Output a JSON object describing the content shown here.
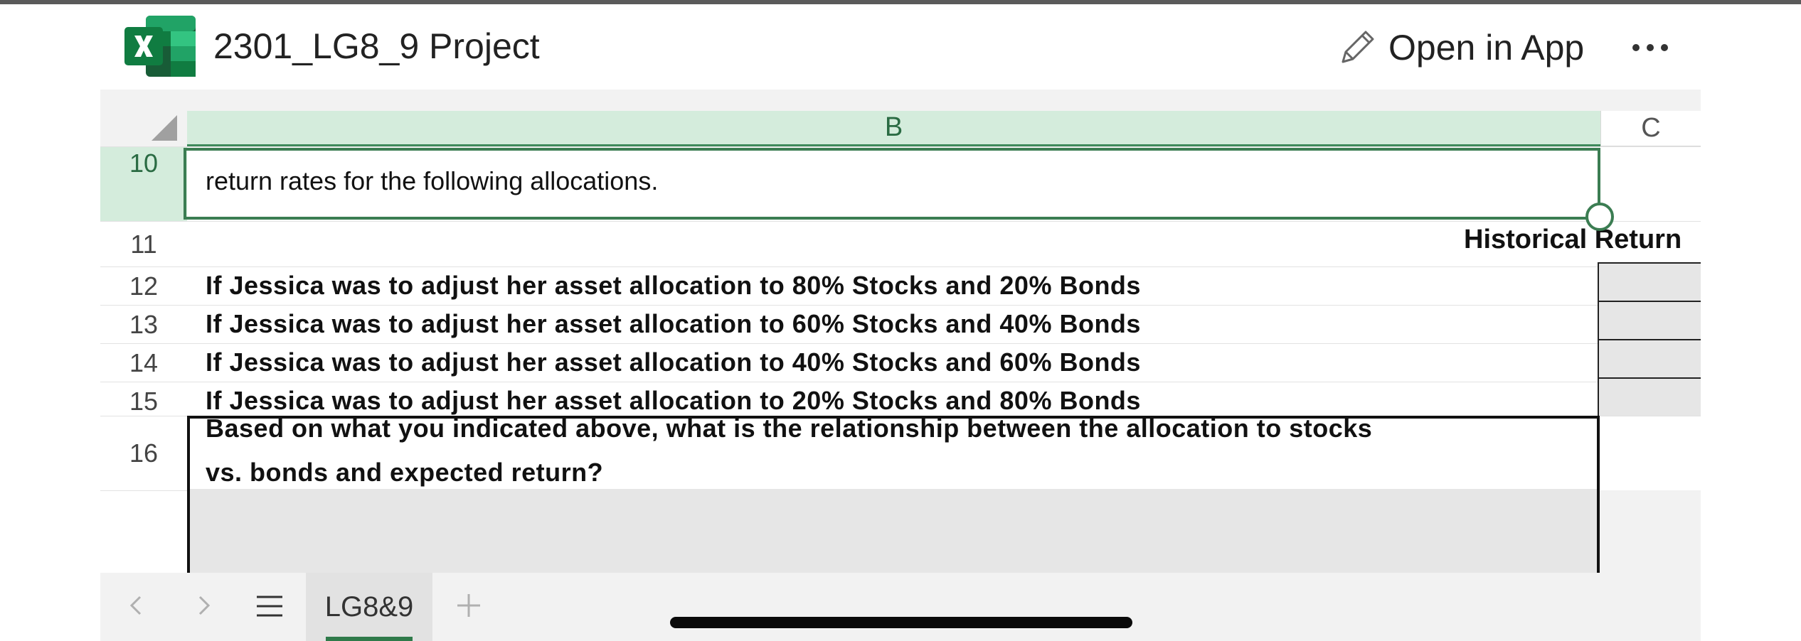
{
  "app": {
    "doc_title": "2301_LG8_9 Project",
    "open_in_app_label": "Open in App",
    "icons": [
      "excel-logo",
      "pencil-icon",
      "more-icon"
    ]
  },
  "grid": {
    "columns": [
      "B",
      "C"
    ],
    "selected_column": "B",
    "rows": [
      {
        "num": "10",
        "text": "return rates for the following allocations.",
        "selected": true
      },
      {
        "num": "11",
        "text": ""
      },
      {
        "num": "12",
        "text": "If Jessica was to adjust her asset allocation to 80% Stocks and 20% Bonds"
      },
      {
        "num": "13",
        "text": "If Jessica was to adjust her asset allocation to 60% Stocks and 40% Bonds"
      },
      {
        "num": "14",
        "text": "If Jessica was to adjust her asset allocation to 40% Stocks and 60% Bonds"
      },
      {
        "num": "15",
        "text": "If Jessica was to adjust her asset allocation to 20% Stocks and 80% Bonds"
      },
      {
        "num": "16",
        "text_line1": "Based on what you indicated above, what is the relationship between the allocation to stocks",
        "text_line2": "vs. bonds and expected return?"
      }
    ],
    "c11_header": "Historical Return",
    "colors": {
      "selection": "#3b7d52",
      "header_selected_bg": "#d4ecdc",
      "input_cell_bg": "#e6e6e6"
    }
  },
  "tabs": {
    "active_sheet": "LG8&9",
    "icons": [
      "chevron-left-icon",
      "chevron-right-icon",
      "sheet-list-icon",
      "add-sheet-icon"
    ]
  }
}
